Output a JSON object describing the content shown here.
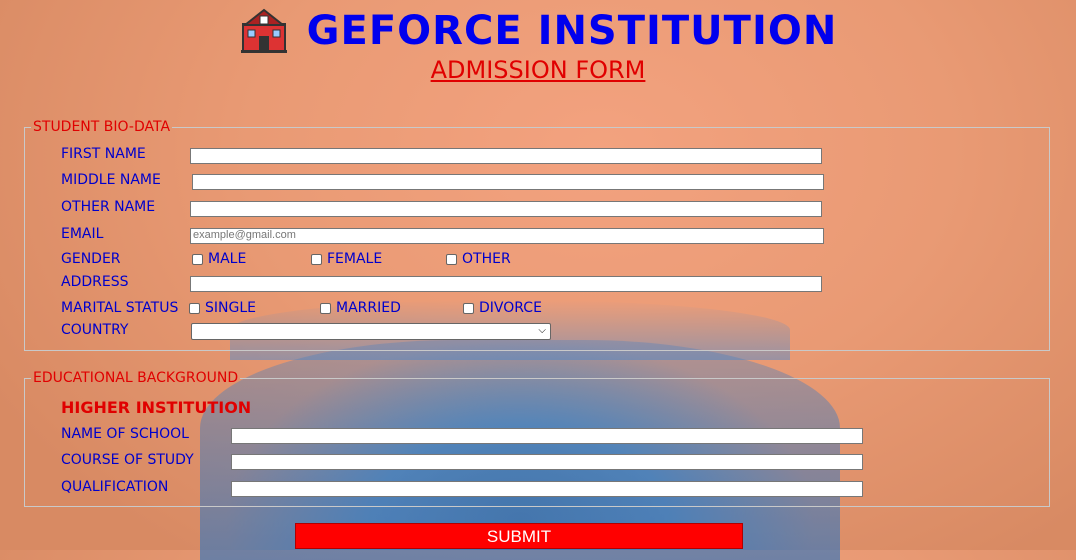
{
  "header": {
    "icon": "school-icon",
    "title": "GEFORCE INSTITUTION",
    "subtitle": "ADMISSION FORM"
  },
  "bio": {
    "legend": "STUDENT BIO-DATA",
    "first_name": "FIRST NAME",
    "middle_name": "MIDDLE NAME",
    "other_name": "OTHER NAME",
    "email": "EMAIL",
    "email_placeholder": "example@gmail.com",
    "gender": "GENDER",
    "gender_options": [
      "MALE",
      "FEMALE",
      "OTHER"
    ],
    "address": "ADDRESS",
    "marital_status": "MARITAL STATUS",
    "marital_options": [
      "SINGLE",
      "MARRIED",
      "DIVORCE"
    ],
    "country": "COUNTRY"
  },
  "edu": {
    "legend": "EDUCATIONAL BACKGROUND",
    "subheading": "HIGHER INSTITUTION",
    "school": "NAME OF SCHOOL",
    "course": "COURSE OF STUDY",
    "qualification": "QUALIFICATION"
  },
  "submit_label": "SUBMIT",
  "colors": {
    "title": "#0000ee",
    "accent_red": "#e00000",
    "label_blue": "#0000cc",
    "submit_bg": "#ff0000"
  }
}
